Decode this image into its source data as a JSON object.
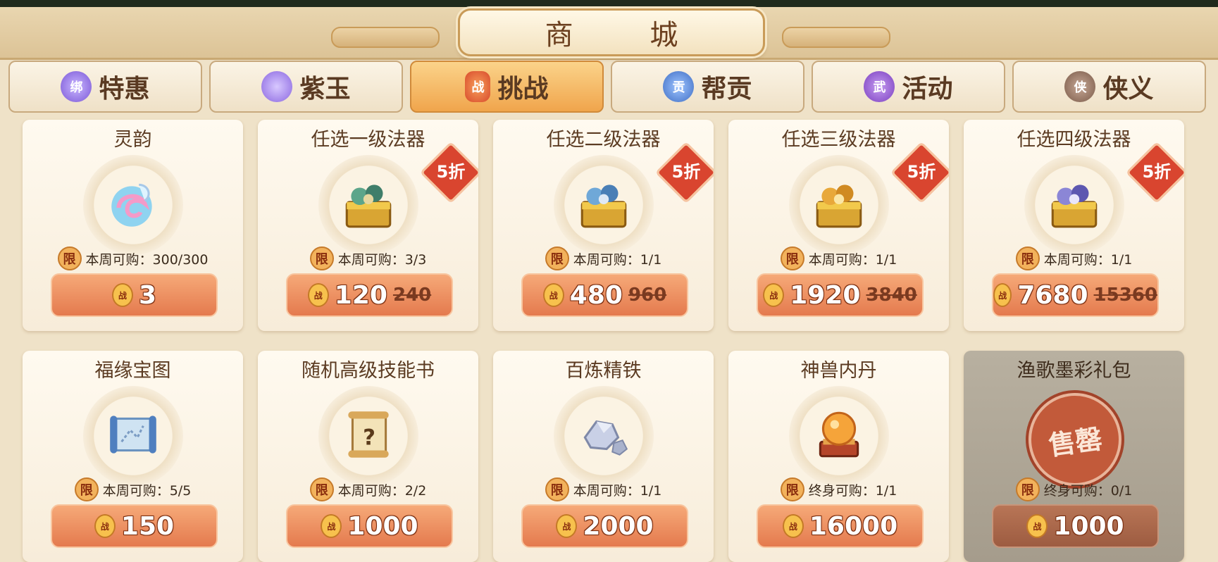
{
  "header": {
    "title": "商    城"
  },
  "tabs": [
    {
      "label": "特惠",
      "icon": "purple-jade-bound-icon",
      "icon_text": "绑"
    },
    {
      "label": "紫玉",
      "icon": "purple-jade-icon",
      "icon_text": ""
    },
    {
      "label": "挑战",
      "icon": "battle-token-icon",
      "icon_text": "战",
      "active": true
    },
    {
      "label": "帮贡",
      "icon": "guild-contribution-icon",
      "icon_text": "贡"
    },
    {
      "label": "活动",
      "icon": "activity-token-icon",
      "icon_text": "武"
    },
    {
      "label": "侠义",
      "icon": "chivalry-token-icon",
      "icon_text": "侠"
    }
  ],
  "currency_glyph": "战",
  "items": [
    {
      "name": "灵韵",
      "limit_badge": "限",
      "limit": "本周可购：300/300",
      "price": "3",
      "old_price": "",
      "discount": ""
    },
    {
      "name": "任选一级法器",
      "limit_badge": "限",
      "limit": "本周可购：3/3",
      "price": "120",
      "old_price": "240",
      "discount": "5折"
    },
    {
      "name": "任选二级法器",
      "limit_badge": "限",
      "limit": "本周可购：1/1",
      "price": "480",
      "old_price": "960",
      "discount": "5折"
    },
    {
      "name": "任选三级法器",
      "limit_badge": "限",
      "limit": "本周可购：1/1",
      "price": "1920",
      "old_price": "3840",
      "discount": "5折"
    },
    {
      "name": "任选四级法器",
      "limit_badge": "限",
      "limit": "本周可购：1/1",
      "price": "7680",
      "old_price": "15360",
      "discount": "5折"
    },
    {
      "name": "福缘宝图",
      "limit_badge": "限",
      "limit": "本周可购：5/5",
      "price": "150",
      "old_price": "",
      "discount": ""
    },
    {
      "name": "随机高级技能书",
      "limit_badge": "限",
      "limit": "本周可购：2/2",
      "price": "1000",
      "old_price": "",
      "discount": ""
    },
    {
      "name": "百炼精铁",
      "limit_badge": "限",
      "limit": "本周可购：1/1",
      "price": "2000",
      "old_price": "",
      "discount": ""
    },
    {
      "name": "神兽内丹",
      "limit_badge": "限",
      "limit": "终身可购：1/1",
      "price": "16000",
      "old_price": "",
      "discount": ""
    },
    {
      "name": "渔歌墨彩礼包",
      "limit_badge": "限",
      "limit": "终身可购：0/1",
      "price": "1000",
      "old_price": "",
      "discount": "",
      "sold_out_stamp": "售罄"
    }
  ],
  "colors": {
    "accent": "#e47a4e",
    "discount": "#d9452f",
    "tab_active": "#f0a54c"
  }
}
